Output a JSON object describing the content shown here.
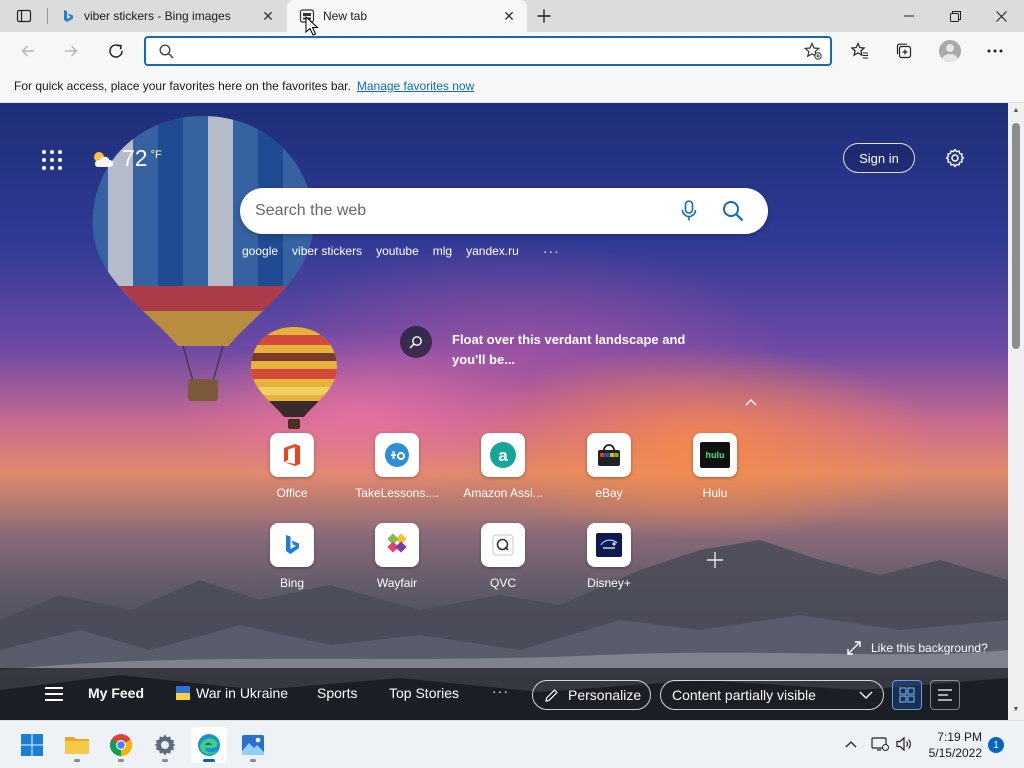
{
  "browser": {
    "tabs": [
      {
        "title": "viber stickers - Bing images",
        "icon": "bing-icon",
        "active": false
      },
      {
        "title": "New tab",
        "icon": "newtab-page-icon",
        "active": true
      }
    ],
    "address": {
      "value": "",
      "placeholder": ""
    },
    "favorites_bar": {
      "message": "For quick access, place your favorites here on the favorites bar.",
      "link": "Manage favorites now"
    }
  },
  "newtab": {
    "weather": {
      "temperature": "72",
      "unit": "°F",
      "icon": "partly-cloudy-icon"
    },
    "sign_in_label": "Sign in",
    "search": {
      "placeholder": "Search the web"
    },
    "quick_links": [
      "google",
      "viber stickers",
      "youtube",
      "mlg",
      "yandex.ru"
    ],
    "quick_links_more": "···",
    "background_caption": "Float over this verdant landscape and you'll be...",
    "top_sites": [
      {
        "label": "Office",
        "icon": "office-icon"
      },
      {
        "label": "TakeLessons....",
        "icon": "takelessons-icon"
      },
      {
        "label": "Amazon Assi...",
        "icon": "amazon-assistant-icon"
      },
      {
        "label": "eBay",
        "icon": "ebay-icon"
      },
      {
        "label": "Hulu",
        "icon": "hulu-icon"
      },
      {
        "label": "Bing",
        "icon": "bing-icon"
      },
      {
        "label": "Wayfair",
        "icon": "wayfair-icon"
      },
      {
        "label": "QVC",
        "icon": "qvc-icon"
      },
      {
        "label": "Disney+",
        "icon": "disney-plus-icon"
      }
    ],
    "hulu_logo_text": "hulu",
    "like_background": "Like this background?",
    "feed": {
      "my_feed": "My Feed",
      "war_in_ukraine": "War in Ukraine",
      "sports": "Sports",
      "top_stories": "Top Stories",
      "more": "···",
      "personalize": "Personalize",
      "content_visibility": "Content partially visible"
    }
  },
  "taskbar": {
    "apps": [
      "start-icon",
      "file-explorer-icon",
      "chrome-icon",
      "settings-icon",
      "edge-icon",
      "photos-icon"
    ],
    "time": "7:19 PM",
    "date": "5/15/2022",
    "notification_count": "1"
  },
  "colors": {
    "accent": "#0f6cbd",
    "taskbar_accent": "#0067c0"
  }
}
